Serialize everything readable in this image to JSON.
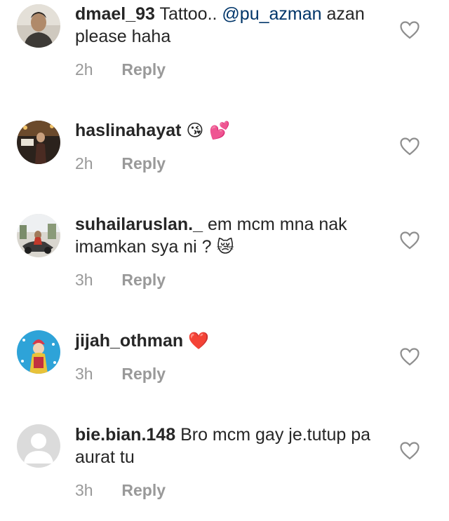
{
  "comments": [
    {
      "username": "dmael_93",
      "text_before": "Tattoo.. ",
      "mention": "@pu_azman",
      "text_after": " azan please haha",
      "emoji": "",
      "time": "2h",
      "reply_label": "Reply",
      "avatar_icon": "profile-photo-icon"
    },
    {
      "username": "haslinahayat",
      "text_before": "",
      "mention": "",
      "text_after": "",
      "emoji": "😘 💕",
      "time": "2h",
      "reply_label": "Reply",
      "avatar_icon": "profile-photo-icon"
    },
    {
      "username": "suhailaruslan._",
      "text_before": "em mcm mna nak imamkan sya ni ?",
      "mention": "",
      "text_after": "",
      "emoji": "😿",
      "time": "3h",
      "reply_label": "Reply",
      "avatar_icon": "profile-photo-icon"
    },
    {
      "username": "jijah_othman",
      "text_before": "",
      "mention": "",
      "text_after": "",
      "emoji": "❤️",
      "time": "3h",
      "reply_label": "Reply",
      "avatar_icon": "profile-photo-icon"
    },
    {
      "username": "bie.bian.148",
      "text_before": "Bro mcm gay je.tutup pa aurat tu",
      "mention": "",
      "text_after": "",
      "emoji": "",
      "time": "3h",
      "reply_label": "Reply",
      "avatar_icon": "default-avatar-icon"
    }
  ],
  "colors": {
    "text": "#262626",
    "mention": "#003569",
    "meta": "#999999",
    "heart_outline": "#8e8e8e"
  }
}
